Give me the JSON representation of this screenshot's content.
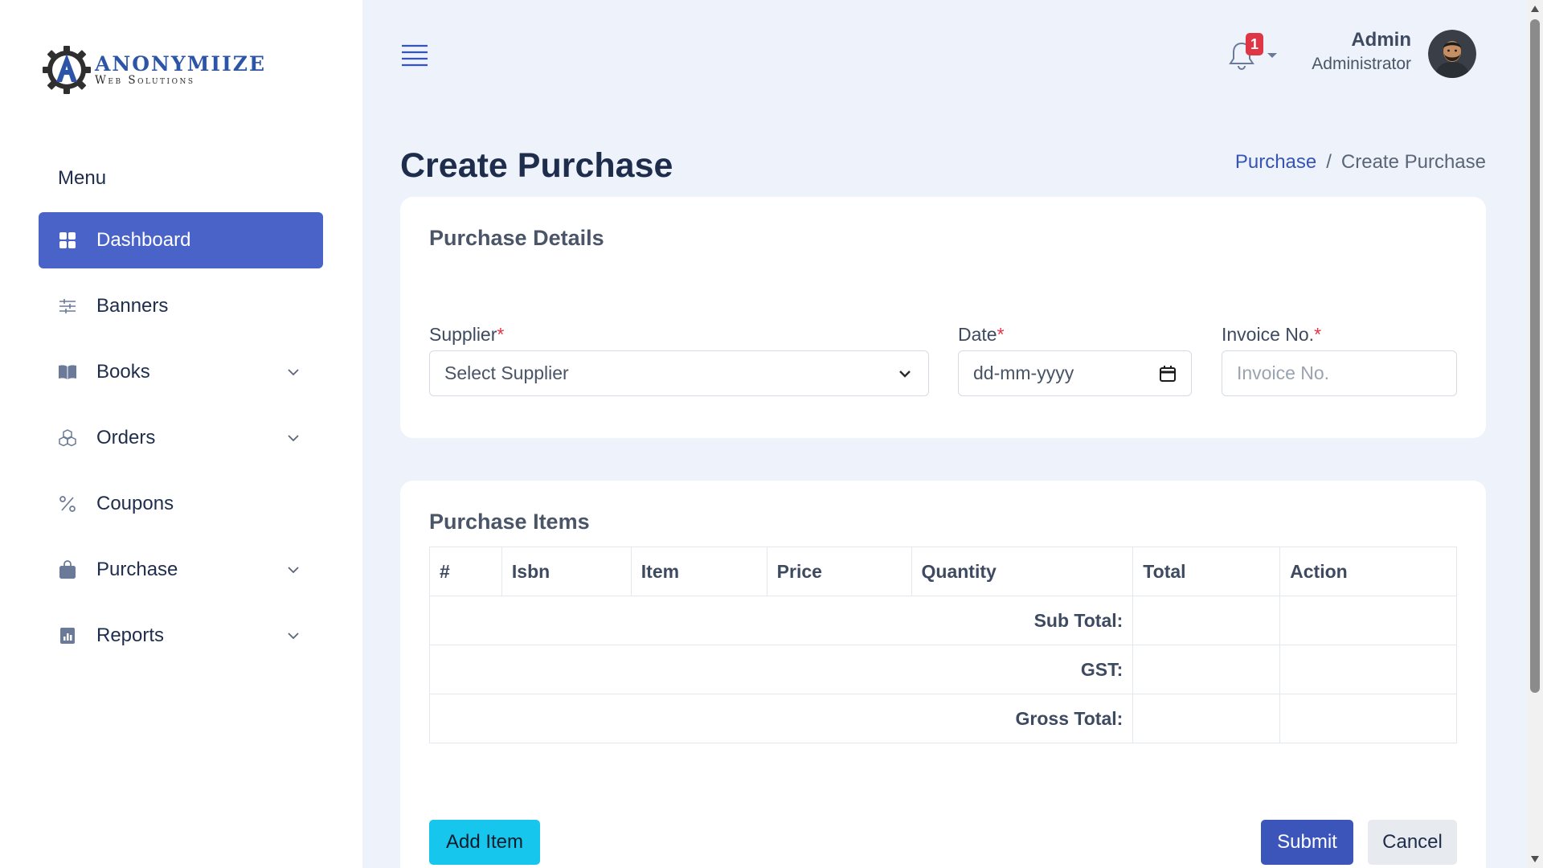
{
  "brand": {
    "name": "ANONYMIIZE",
    "tagline": "Web Solutions",
    "logo_icon": "gear-letter-a-logo",
    "primary_color": "#4a63c8",
    "accent_color": "#2c55a8"
  },
  "sidebar": {
    "heading": "Menu",
    "items": [
      {
        "label": "Dashboard",
        "icon": "grid-icon",
        "active": true,
        "expandable": false
      },
      {
        "label": "Banners",
        "icon": "sliders-icon",
        "active": false,
        "expandable": false
      },
      {
        "label": "Books",
        "icon": "book-icon",
        "active": false,
        "expandable": true
      },
      {
        "label": "Orders",
        "icon": "boxes-icon",
        "active": false,
        "expandable": true
      },
      {
        "label": "Coupons",
        "icon": "percent-icon",
        "active": false,
        "expandable": false
      },
      {
        "label": "Purchase",
        "icon": "bag-icon",
        "active": false,
        "expandable": true
      },
      {
        "label": "Reports",
        "icon": "bar-chart-icon",
        "active": false,
        "expandable": true
      }
    ]
  },
  "header": {
    "notification_count": "1",
    "badge_color": "#e03545",
    "user_name": "Admin",
    "user_role": "Administrator"
  },
  "page": {
    "title": "Create Purchase",
    "breadcrumb": {
      "parent": "Purchase",
      "separator": "/",
      "current": "Create Purchase"
    }
  },
  "details": {
    "title": "Purchase Details",
    "required_mark": "*",
    "supplier": {
      "label": "Supplier",
      "value": "Select Supplier"
    },
    "date": {
      "label": "Date",
      "value": "dd-mm-yyyy"
    },
    "invoice": {
      "label": "Invoice No.",
      "placeholder": "Invoice No."
    }
  },
  "items": {
    "title": "Purchase Items",
    "columns": [
      "#",
      "Isbn",
      "Item",
      "Price",
      "Quantity",
      "Total",
      "Action"
    ],
    "summary": {
      "sub_total": "Sub Total:",
      "gst": "GST:",
      "gross_total": "Gross Total:"
    }
  },
  "actions": {
    "add_item": "Add Item",
    "submit": "Submit",
    "cancel": "Cancel",
    "add_color": "#17c6ec",
    "submit_color": "#3b55bb",
    "cancel_color": "#e7eaee"
  }
}
